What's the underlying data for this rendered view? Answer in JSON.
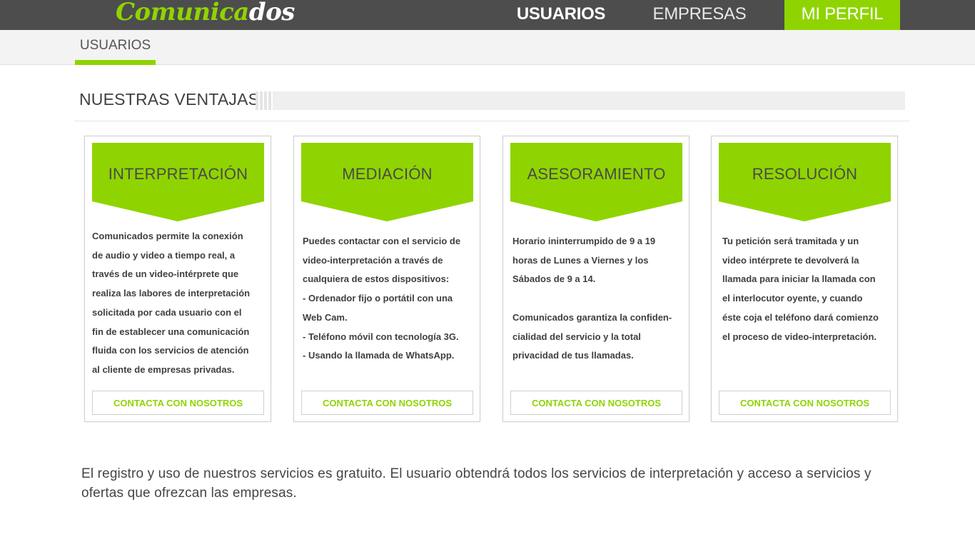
{
  "header": {
    "logo_part1": "Comunica",
    "logo_part2": "dos",
    "nav": [
      {
        "label": "USUARIOS"
      },
      {
        "label": "EMPRESAS"
      },
      {
        "label": "MI PERFIL"
      }
    ]
  },
  "subnav": {
    "active_tab": "USUARIOS"
  },
  "section": {
    "title": "NUESTRAS VENTAJAS"
  },
  "cards": [
    {
      "title": "INTERPRETACIÓN",
      "text": "Comunicados permite la conexión\nde audio y video a tiempo real, a\ntravés de un video-intérprete que\nrealiza las labores de interpretación\nsolicitada por cada usuario con el\nfin de establecer una comunicación\nfluida con los servicios de atención\nal cliente de empresas privadas.",
      "button": "CONTACTA CON NOSOTROS"
    },
    {
      "title": "MEDIACIÓN",
      "text": "Puedes contactar con el servicio de\nvideo-interpretación a través de\ncualquiera de estos dispositivos:\n- Ordenador fijo o portátil con una\nWeb Cam.\n- Teléfono móvil con tecnología 3G.\n- Usando la llamada de WhatsApp.",
      "button": "CONTACTA CON NOSOTROS"
    },
    {
      "title": "ASESORAMIENTO",
      "text": "Horario ininterrumpido de 9 a 19\nhoras de Lunes a Viernes y los\nSábados  de 9 a 14.\n\nComunicados garantiza la confiden-\ncialidad del servicio y la total\nprivacidad de tus llamadas.",
      "button": "CONTACTA CON NOSOTROS"
    },
    {
      "title": "RESOLUCIÓN",
      "text": "Tu petición será tramitada y un\nvideo intérprete te devolverá la\nllamada para iniciar la llamada con\nel interlocutor oyente, y cuando\néste coja el teléfono dará comienzo\nel proceso de video-interpretación.",
      "button": "CONTACTA CON NOSOTROS"
    }
  ],
  "footer": {
    "text": "El registro y uso de nuestros servicios es gratuito. El usuario obtendrá todos los servicios de interpretación y acceso a servicios y ofertas que ofrezcan las empresas."
  },
  "colors": {
    "accent": "#8fd400",
    "topbar": "#4d4d4d",
    "subbar": "#f3f3f3"
  }
}
